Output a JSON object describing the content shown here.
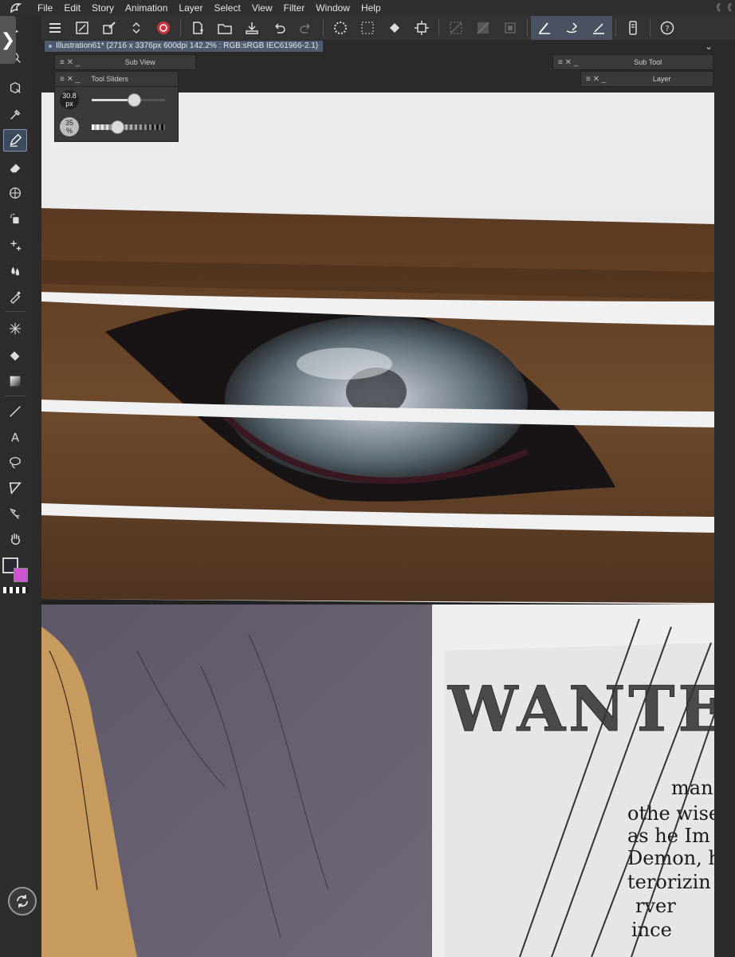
{
  "menu": {
    "items": [
      "File",
      "Edit",
      "Story",
      "Animation",
      "Layer",
      "Select",
      "View",
      "Filter",
      "Window",
      "Help"
    ]
  },
  "document": {
    "title": "Illustration61* (2716 x 3376px 600dpi 142.2% : RGB:sRGB IEC61966-2.1)"
  },
  "palettes": {
    "sub_view": "Sub View",
    "tool_sliders": "Tool Sliders",
    "sub_tool": "Sub Tool",
    "layer": "Layer"
  },
  "tool_sliders": {
    "brush_size_value": "30.8",
    "brush_size_unit": "px",
    "brush_size_fraction": 0.58,
    "opacity_value": "35",
    "opacity_unit": "%",
    "opacity_fraction": 0.35
  },
  "colors": {
    "main_color": "#272731",
    "sub_color": "#cf54cf",
    "active_tool_highlight": "#7f97bd"
  },
  "toolbar": {
    "active_tool": "pen-icon",
    "tools": [
      "operation-icon",
      "move-icon",
      "eyedropper-icon",
      "pen-icon",
      "eraser-icon",
      "3d-icon",
      "airbrush-icon",
      "decoration-icon",
      "blend-icon",
      "correct-line-icon",
      "auto-select-icon",
      "fill-icon",
      "gradient-icon",
      "line-icon",
      "text-icon",
      "lasso-icon",
      "frame-icon",
      "link-icon",
      "hand-icon"
    ]
  },
  "artwork": {
    "poster_text": "WANTE",
    "poster_lines": [
      "man",
      "othe wise",
      "as he Im",
      "Demon, h",
      "terorizin",
      "rver",
      "ince"
    ]
  }
}
